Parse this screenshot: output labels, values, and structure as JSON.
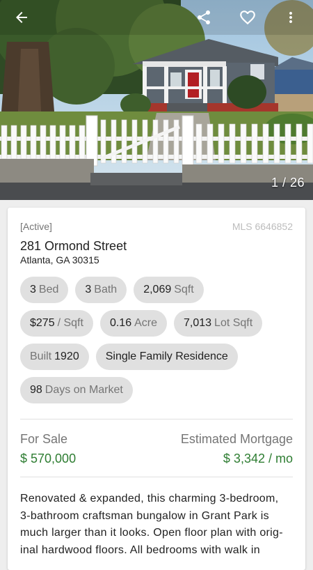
{
  "hero": {
    "photo_counter": "1 / 26",
    "icons": [
      "back-arrow-icon",
      "share-icon",
      "heart-icon",
      "more-vert-icon"
    ]
  },
  "listing": {
    "status": "[Active]",
    "mls": "MLS 6646852",
    "street": "281 Ormond Street",
    "city_state_zip": "Atlanta, GA 30315",
    "chips": [
      {
        "value": "3",
        "unit": "Bed"
      },
      {
        "value": "3",
        "unit": "Bath"
      },
      {
        "value": "2,069",
        "unit": "Sqft"
      },
      {
        "value": "$275",
        "unit": "/ Sqft"
      },
      {
        "value": "0.16",
        "unit": "Acre"
      },
      {
        "value": "7,013",
        "unit": "Lot Sqft"
      },
      {
        "value": "Built",
        "unit": "1920"
      },
      {
        "value": "Single Family Residence",
        "unit": ""
      },
      {
        "value": "98",
        "unit": "Days on Market"
      }
    ],
    "for_sale_label": "For Sale",
    "for_sale_price": "$ 570,000",
    "mortgage_label": "Estimated Mortgage",
    "mortgage_value": "$ 3,342 / mo",
    "description_lines": [
      "Renovated & expanded, this charming 3-bedroom,",
      "3-bathroom craftsman bungalow in Grant Park is",
      "much larger than it looks. Open floor plan with orig-",
      "inal hardwood floors. All bedrooms with walk in"
    ]
  },
  "colors": {
    "price_green": "#2e7d32",
    "chip_bg": "#e0e0e0",
    "secondary_text": "#757575"
  }
}
